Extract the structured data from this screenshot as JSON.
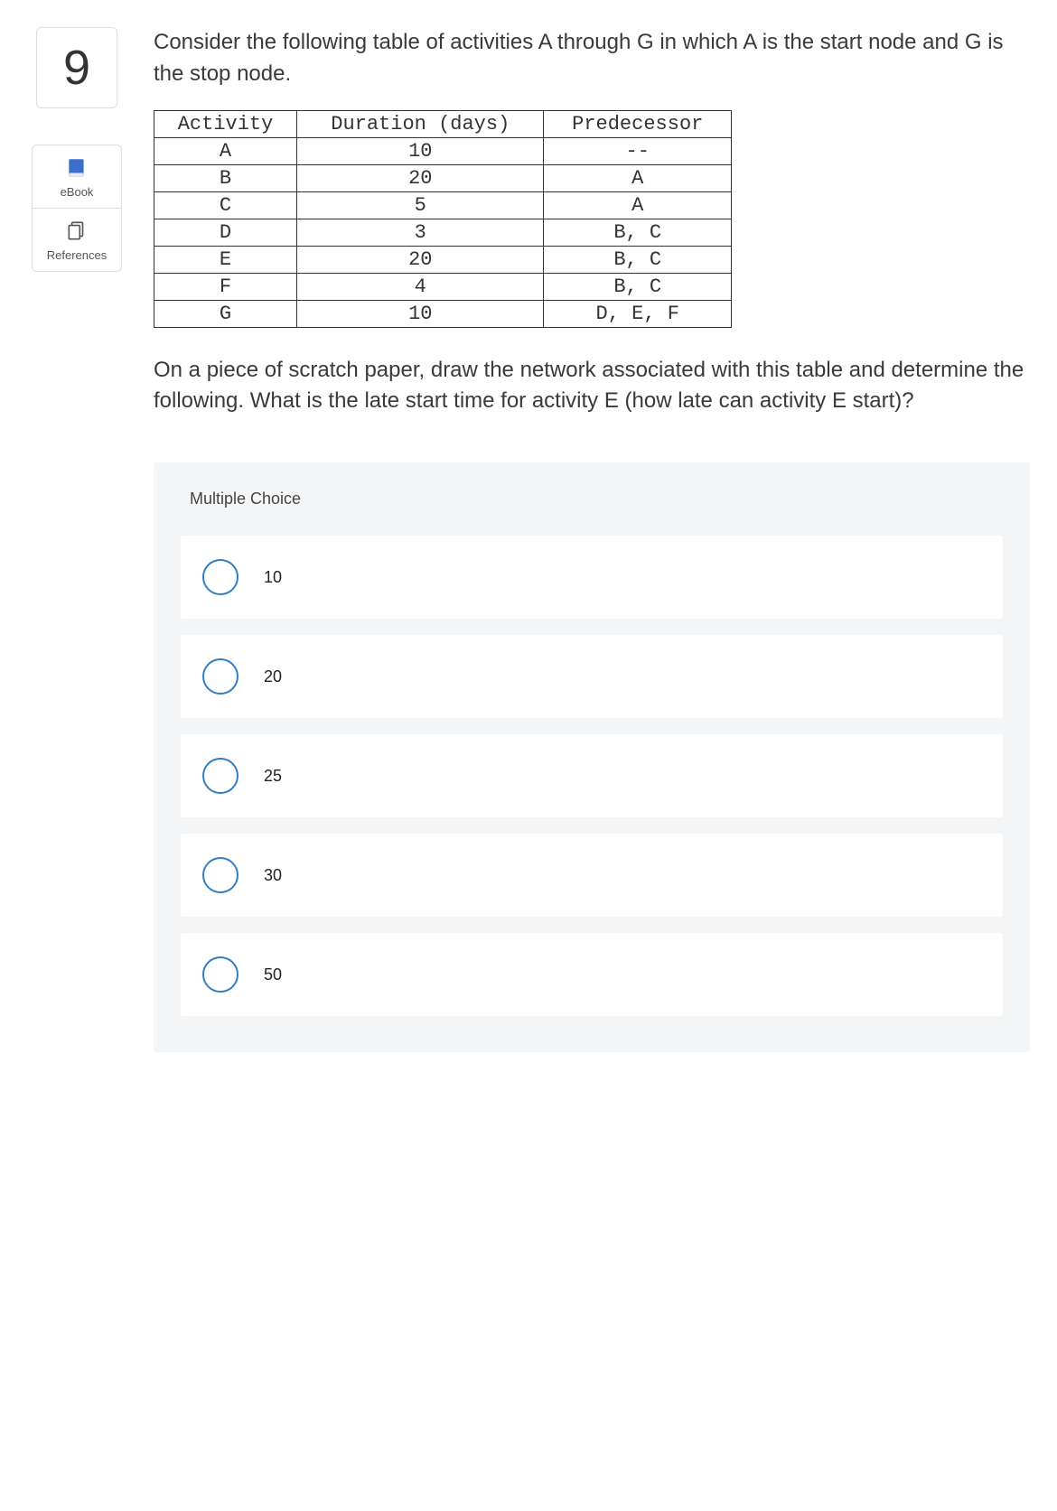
{
  "question_number": "9",
  "sidebar": {
    "ebook_label": "eBook",
    "references_label": "References"
  },
  "prompt_intro": "Consider the following table of activities A through G in which A is the start node and G is the stop node.",
  "table": {
    "headers": [
      "Activity",
      "Duration (days)",
      "Predecessor"
    ],
    "rows": [
      [
        "A",
        "10",
        "--"
      ],
      [
        "B",
        "20",
        "A"
      ],
      [
        "C",
        "5",
        "A"
      ],
      [
        "D",
        "3",
        "B, C"
      ],
      [
        "E",
        "20",
        "B, C"
      ],
      [
        "F",
        "4",
        "B, C"
      ],
      [
        "G",
        "10",
        "D, E, F"
      ]
    ]
  },
  "prompt_followup": "On a piece of scratch paper, draw the network associated with this table and determine the following. What is the late start time for activity E (how late can activity E start)?",
  "mc": {
    "title": "Multiple Choice",
    "options": [
      "10",
      "20",
      "25",
      "30",
      "50"
    ]
  }
}
